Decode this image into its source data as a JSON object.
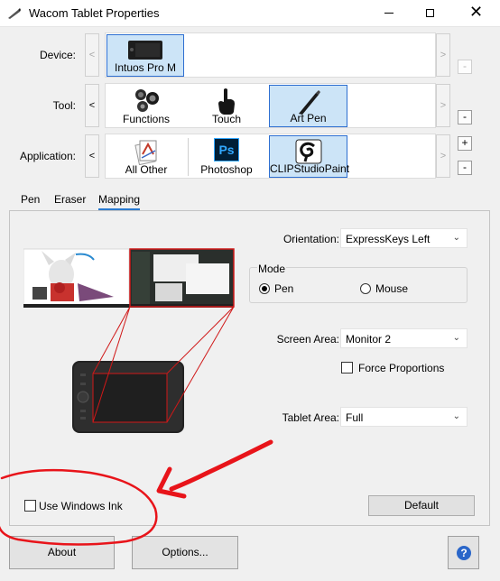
{
  "window": {
    "title": "Wacom Tablet Properties",
    "minimize_glyph": "–",
    "maximize_glyph": "□",
    "close_glyph": "✕"
  },
  "device_row": {
    "label": "Device:",
    "items": [
      {
        "label": "Intuos Pro M",
        "icon": "tablet-icon",
        "selected": true
      }
    ],
    "prev": "<",
    "next": ">",
    "remove_label": "-"
  },
  "tool_row": {
    "label": "Tool:",
    "items": [
      {
        "label": "Functions",
        "icon": "functions-icon",
        "selected": false
      },
      {
        "label": "Touch",
        "icon": "touch-hand-icon",
        "selected": false
      },
      {
        "label": "Art Pen",
        "icon": "art-pen-icon",
        "selected": true
      }
    ],
    "prev": "<",
    "next": ">",
    "remove_label": "-"
  },
  "application_row": {
    "label": "Application:",
    "items": [
      {
        "label": "All Other",
        "icon": "all-other-apps-icon",
        "selected": false
      },
      {
        "label": "Photoshop",
        "icon": "photoshop-icon",
        "icon_text": "Ps",
        "selected": false
      },
      {
        "label": "CLIPStudioPaint",
        "icon": "clip-studio-paint-icon",
        "selected": true
      }
    ],
    "prev": "<",
    "next": ">",
    "add_label": "+",
    "remove_label": "-"
  },
  "tabs": [
    {
      "label": "Pen",
      "active": false
    },
    {
      "label": "Eraser",
      "active": false
    },
    {
      "label": "Mapping",
      "active": true
    }
  ],
  "mapping": {
    "orientation": {
      "label": "Orientation:",
      "value": "ExpressKeys Left"
    },
    "mode": {
      "title": "Mode",
      "options": [
        {
          "label": "Pen",
          "selected": true
        },
        {
          "label": "Mouse",
          "selected": false
        }
      ]
    },
    "screen_area": {
      "label": "Screen Area:",
      "value": "Monitor 2"
    },
    "force_proportions": {
      "label": "Force Proportions",
      "checked": false
    },
    "tablet_area": {
      "label": "Tablet Area:",
      "value": "Full"
    },
    "use_windows_ink": {
      "label": "Use Windows Ink",
      "checked": false
    },
    "default_button": "Default",
    "dropdown_arrow": "⌄"
  },
  "footer": {
    "about_button": "About",
    "options_button": "Options...",
    "help_glyph": "?"
  },
  "colors": {
    "selection_fill": "#cce4f7",
    "selection_border": "#2e6fd1",
    "mapping_lines": "#d01818",
    "annotation_red": "#e8141a",
    "help_blue": "#2a66c9"
  }
}
